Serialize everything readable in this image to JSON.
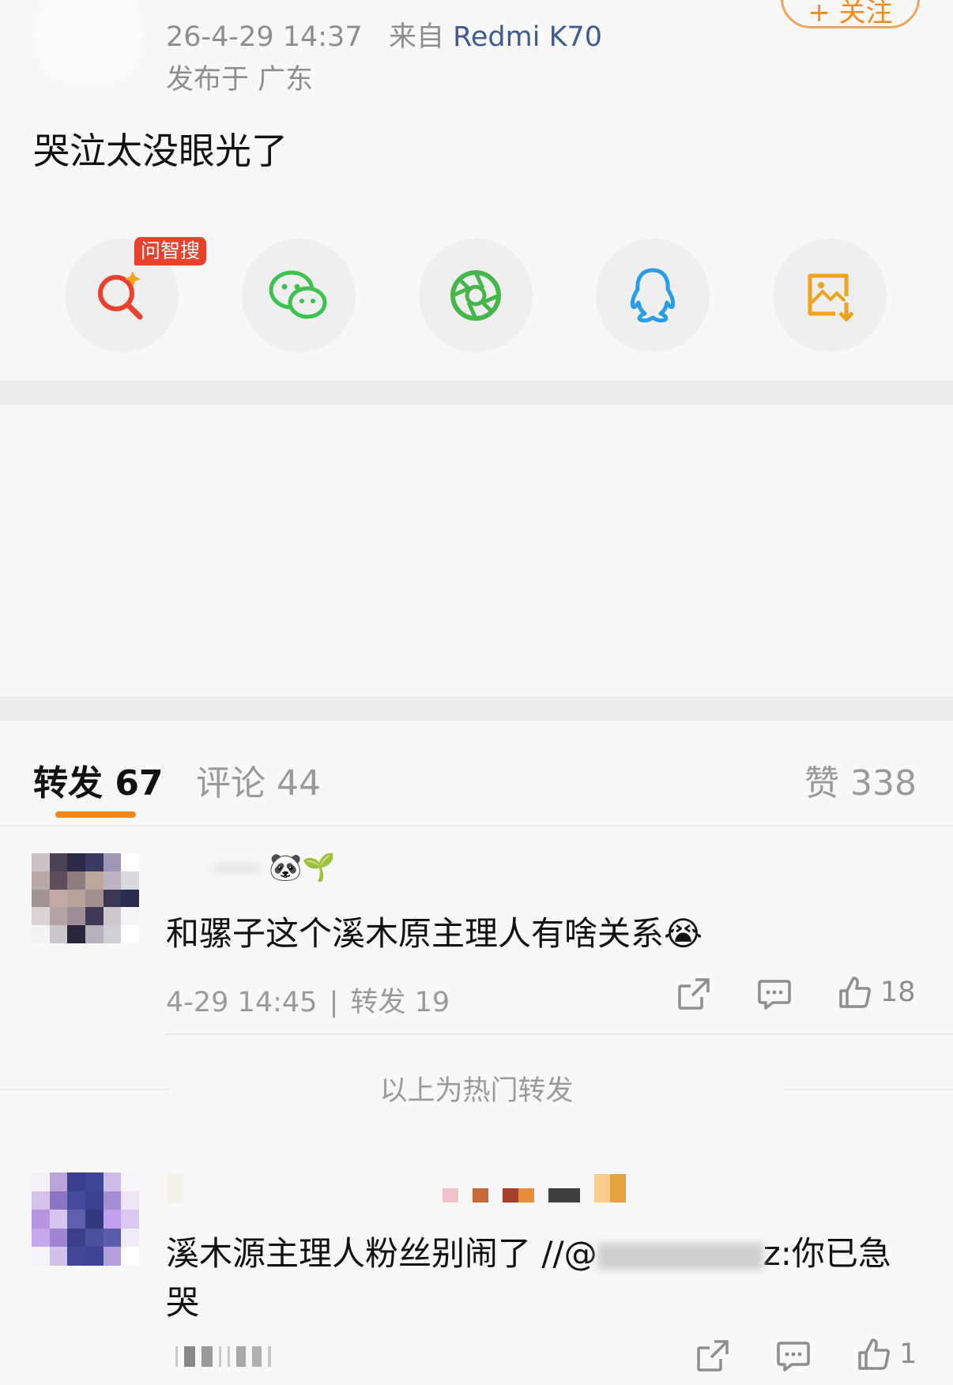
{
  "post": {
    "time": "26-4-29 14:37",
    "from_prefix": "来自",
    "device": "Redmi K70",
    "location": "发布于 广东",
    "follow_label": "+ 关注",
    "content": "哭泣太没眼光了"
  },
  "share": {
    "ai_badge": "问智搜",
    "items": [
      {
        "icon": "ai-search-icon",
        "color": "#e8412e"
      },
      {
        "icon": "wechat-icon",
        "color": "#3cc24f"
      },
      {
        "icon": "moments-icon",
        "color": "#45b64a"
      },
      {
        "icon": "qq-icon",
        "color": "#2a9de8"
      },
      {
        "icon": "save-image-icon",
        "color": "#f0a21b"
      }
    ]
  },
  "tabs": {
    "repost": "转发 67",
    "comment": "评论 44",
    "like": "赞 338",
    "active_color": "#f28a1b"
  },
  "comments": [
    {
      "name_emoji": "🐼🌱",
      "text": "和骡子这个溪木原主理人有啥关系😭",
      "time": "4-29 14:45",
      "sep": "|",
      "reposts": "转发 19",
      "likes": "18"
    },
    {
      "text_line1": "溪木源主理人粉丝别闹了 //@",
      "mention_tail": "z:你已急",
      "text_line2": "哭",
      "likes": "1"
    }
  ],
  "hot_label": "以上为热门转发"
}
